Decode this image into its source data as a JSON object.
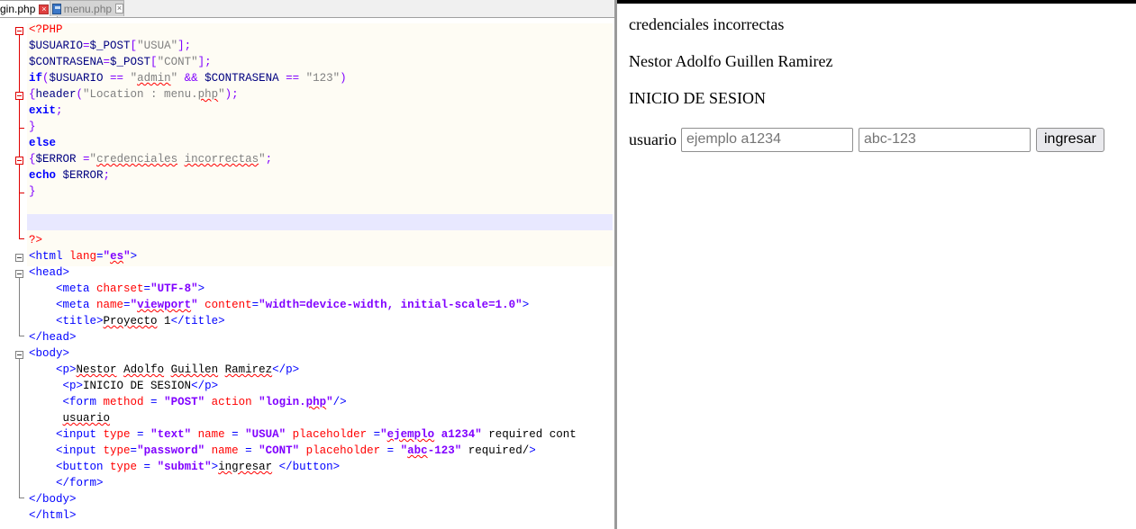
{
  "editor": {
    "tabs": [
      {
        "label": "gin.php",
        "active": true
      },
      {
        "label": "menu.php",
        "active": false
      }
    ],
    "code_lines": [
      [
        [
          "php",
          "<?PHP"
        ]
      ],
      [
        [
          "var",
          "$USUARIO"
        ],
        [
          "op",
          "="
        ],
        [
          "var",
          "$_POST"
        ],
        [
          "op",
          "["
        ],
        [
          "str",
          "\"USUA\""
        ],
        [
          "op",
          "];"
        ]
      ],
      [
        [
          "var",
          "$CONTRASENA"
        ],
        [
          "op",
          "="
        ],
        [
          "var",
          "$_POST"
        ],
        [
          "op",
          "["
        ],
        [
          "str",
          "\"CONT\""
        ],
        [
          "op",
          "];"
        ]
      ],
      [
        [
          "kw",
          "if"
        ],
        [
          "op",
          "("
        ],
        [
          "var",
          "$USUARIO"
        ],
        [
          "op",
          " == "
        ],
        [
          "str",
          "\""
        ],
        [
          "strsq",
          "admin"
        ],
        [
          "str",
          "\""
        ],
        [
          "op",
          " && "
        ],
        [
          "var",
          "$CONTRASENA"
        ],
        [
          "op",
          " == "
        ],
        [
          "str",
          "\"123\""
        ],
        [
          "op",
          ")"
        ]
      ],
      [
        [
          "op",
          "{"
        ],
        [
          "var",
          "header"
        ],
        [
          "op",
          "("
        ],
        [
          "str",
          "\"Location : menu."
        ],
        [
          "strsq",
          "php"
        ],
        [
          "str",
          "\""
        ],
        [
          "op",
          ");"
        ]
      ],
      [
        [
          "kw",
          "exit"
        ],
        [
          "op",
          ";"
        ]
      ],
      [
        [
          "op",
          "}"
        ]
      ],
      [
        [
          "kw",
          "else"
        ]
      ],
      [
        [
          "op",
          "{"
        ],
        [
          "var",
          "$ERROR "
        ],
        [
          "op",
          "="
        ],
        [
          "str",
          "\""
        ],
        [
          "strsq",
          "credenciales"
        ],
        [
          "str",
          " "
        ],
        [
          "strsq",
          "incorrectas"
        ],
        [
          "str",
          "\""
        ],
        [
          "op",
          ";"
        ]
      ],
      [
        [
          "kw",
          "echo"
        ],
        [
          "var",
          " $ERROR"
        ],
        [
          "op",
          ";"
        ]
      ],
      [
        [
          "op",
          "}"
        ]
      ],
      [],
      [],
      [
        [
          "php",
          "?>"
        ]
      ],
      [
        [
          "tg",
          "<html "
        ],
        [
          "at",
          "lang"
        ],
        [
          "tg",
          "="
        ],
        [
          "av",
          "\""
        ],
        [
          "avsq",
          "es"
        ],
        [
          "av",
          "\""
        ],
        [
          "tg",
          ">"
        ]
      ],
      [
        [
          "tg",
          "<head>"
        ]
      ],
      [
        [
          "tx",
          "    "
        ],
        [
          "tg",
          "<meta "
        ],
        [
          "at",
          "charset"
        ],
        [
          "tg",
          "="
        ],
        [
          "av",
          "\"UTF-8\""
        ],
        [
          "tg",
          ">"
        ]
      ],
      [
        [
          "tx",
          "    "
        ],
        [
          "tg",
          "<meta "
        ],
        [
          "at",
          "name"
        ],
        [
          "tg",
          "="
        ],
        [
          "av",
          "\""
        ],
        [
          "avsq",
          "viewport"
        ],
        [
          "av",
          "\""
        ],
        [
          "at",
          " content"
        ],
        [
          "tg",
          "="
        ],
        [
          "av",
          "\"width=device-width, initial-scale=1.0\""
        ],
        [
          "tg",
          ">"
        ]
      ],
      [
        [
          "tx",
          "    "
        ],
        [
          "tg",
          "<title>"
        ],
        [
          "txsq",
          "Proyecto"
        ],
        [
          "tx",
          " 1"
        ],
        [
          "tg",
          "</title>"
        ]
      ],
      [
        [
          "tg",
          "</head>"
        ]
      ],
      [
        [
          "tg",
          "<body>"
        ]
      ],
      [
        [
          "tx",
          "    "
        ],
        [
          "tg",
          "<p>"
        ],
        [
          "txsq",
          "Nestor"
        ],
        [
          "tx",
          " "
        ],
        [
          "txsq",
          "Adolfo"
        ],
        [
          "tx",
          " "
        ],
        [
          "txsq",
          "Guillen"
        ],
        [
          "tx",
          " "
        ],
        [
          "txsq",
          "Ramirez"
        ],
        [
          "tg",
          "</p>"
        ]
      ],
      [
        [
          "tx",
          "     "
        ],
        [
          "tg",
          "<p>"
        ],
        [
          "tx",
          "INICIO DE SESION"
        ],
        [
          "tg",
          "</p>"
        ]
      ],
      [
        [
          "tx",
          "     "
        ],
        [
          "tg",
          "<form "
        ],
        [
          "at",
          "method"
        ],
        [
          "tg",
          " = "
        ],
        [
          "av",
          "\"POST\""
        ],
        [
          "at",
          " action "
        ],
        [
          "av",
          "\"login."
        ],
        [
          "avsq",
          "php"
        ],
        [
          "av",
          "\""
        ],
        [
          "tg",
          "/>"
        ]
      ],
      [
        [
          "tx",
          "     "
        ],
        [
          "txsq",
          "usuario"
        ]
      ],
      [
        [
          "tx",
          "    "
        ],
        [
          "tg",
          "<input "
        ],
        [
          "at",
          "type"
        ],
        [
          "tg",
          " = "
        ],
        [
          "av",
          "\"text\""
        ],
        [
          "at",
          " name"
        ],
        [
          "tg",
          " = "
        ],
        [
          "av",
          "\"USUA\""
        ],
        [
          "at",
          " placeholder"
        ],
        [
          "tg",
          " ="
        ],
        [
          "av",
          "\""
        ],
        [
          "avsq",
          "ejemplo"
        ],
        [
          "av",
          " a1234\""
        ],
        [
          "tx",
          " required cont"
        ]
      ],
      [
        [
          "tx",
          "    "
        ],
        [
          "tg",
          "<input "
        ],
        [
          "at",
          "type"
        ],
        [
          "tg",
          "="
        ],
        [
          "av",
          "\"password\""
        ],
        [
          "at",
          " name"
        ],
        [
          "tg",
          " = "
        ],
        [
          "av",
          "\"CONT\""
        ],
        [
          "at",
          " placeholder"
        ],
        [
          "tg",
          " = "
        ],
        [
          "av",
          "\""
        ],
        [
          "avsq",
          "abc"
        ],
        [
          "av",
          "-123\""
        ],
        [
          "tx",
          " required/"
        ],
        [
          "tg",
          ">"
        ]
      ],
      [
        [
          "tx",
          "    "
        ],
        [
          "tg",
          "<button "
        ],
        [
          "at",
          "type"
        ],
        [
          "tg",
          " = "
        ],
        [
          "av",
          "\"submit\""
        ],
        [
          "tg",
          ">"
        ],
        [
          "txsq",
          "ingresar"
        ],
        [
          "tx",
          " "
        ],
        [
          "tg",
          "</button>"
        ]
      ],
      [
        [
          "tx",
          "    "
        ],
        [
          "tg",
          "</form>"
        ]
      ],
      [
        [
          "tg",
          "</body>"
        ]
      ],
      [
        [
          "tg",
          "</html>"
        ]
      ]
    ]
  },
  "browser": {
    "message": "credenciales incorrectas",
    "author": "Nestor Adolfo Guillen Ramirez",
    "heading": "INICIO DE SESION",
    "form": {
      "label": "usuario",
      "user_placeholder": "ejemplo a1234",
      "pass_placeholder": "abc-123",
      "submit_label": "ingresar"
    }
  }
}
